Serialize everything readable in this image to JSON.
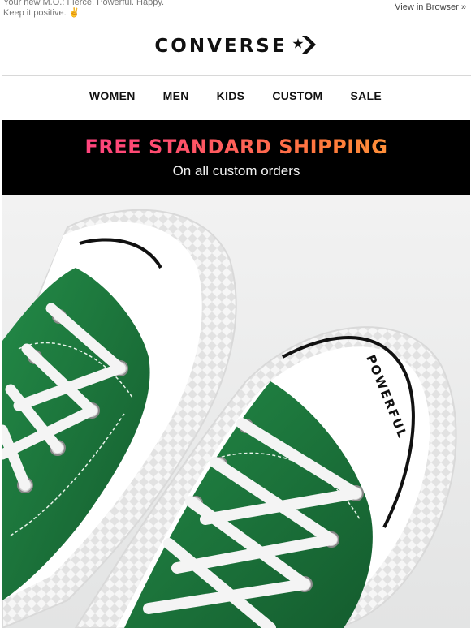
{
  "preheader": {
    "line1": "Your new M.O.: Fierce. Powerful. Happy.",
    "line2": "Keep it positive. ✌",
    "view_link": "View in Browser",
    "view_suffix": " »"
  },
  "brand": {
    "name": "CONVERSE",
    "logo_icon": "star-chevron-icon"
  },
  "nav": {
    "items": [
      {
        "label": "WOMEN"
      },
      {
        "label": "MEN"
      },
      {
        "label": "KIDS"
      },
      {
        "label": "CUSTOM"
      },
      {
        "label": "SALE"
      }
    ]
  },
  "promo": {
    "headline": "FREE STANDARD SHIPPING",
    "subline": "On all custom orders"
  },
  "hero": {
    "toe_text": "POWERFUL",
    "colors": {
      "canvas": "#1e7a3f",
      "rubber": "#ffffff",
      "laces": "#f4f4f4",
      "background": "#eceded"
    }
  }
}
